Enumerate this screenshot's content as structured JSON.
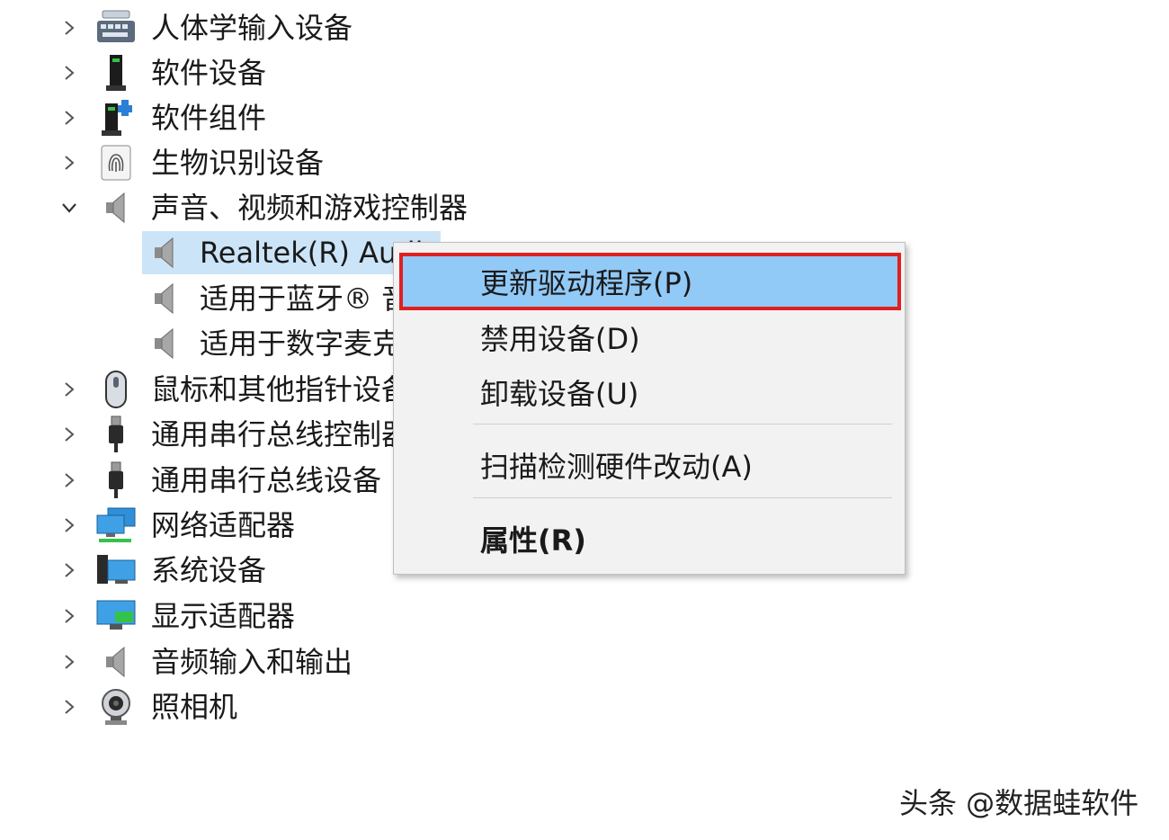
{
  "tree": {
    "categories_top": [
      {
        "label": "人体学输入设备",
        "icon": "keyboard-icon",
        "expanded": false
      },
      {
        "label": "软件设备",
        "icon": "tower-icon",
        "expanded": false
      },
      {
        "label": "软件组件",
        "icon": "tower-puzzle-icon",
        "expanded": false
      },
      {
        "label": "生物识别设备",
        "icon": "fingerprint-icon",
        "expanded": false
      },
      {
        "label": "声音、视频和游戏控制器",
        "icon": "speaker-icon",
        "expanded": true
      }
    ],
    "children": [
      {
        "label": "Realtek(R) Audio",
        "icon": "speaker-icon",
        "selected": true
      },
      {
        "label": "适用于蓝牙® 音频",
        "icon": "speaker-icon",
        "selected": false
      },
      {
        "label": "适用于数字麦克风",
        "icon": "speaker-icon",
        "selected": false
      }
    ],
    "categories_bottom": [
      {
        "label": "鼠标和其他指针设备",
        "icon": "mouse-icon",
        "expanded": false
      },
      {
        "label": "通用串行总线控制器",
        "icon": "usb-icon",
        "expanded": false
      },
      {
        "label": "通用串行总线设备",
        "icon": "usb-icon",
        "expanded": false
      },
      {
        "label": "网络适配器",
        "icon": "network-icon",
        "expanded": false
      },
      {
        "label": "系统设备",
        "icon": "system-icon",
        "expanded": false
      },
      {
        "label": "显示适配器",
        "icon": "display-icon",
        "expanded": false
      },
      {
        "label": "音频输入和输出",
        "icon": "speaker-icon",
        "expanded": false
      },
      {
        "label": "照相机",
        "icon": "camera-icon",
        "expanded": false
      }
    ]
  },
  "context_menu": {
    "items": [
      {
        "label": "更新驱动程序(P)",
        "highlighted": true,
        "bold": false
      },
      {
        "label": "禁用设备(D)",
        "highlighted": false,
        "bold": false
      },
      {
        "label": "卸载设备(U)",
        "highlighted": false,
        "bold": false
      },
      {
        "label": "扫描检测硬件改动(A)",
        "highlighted": false,
        "bold": false
      },
      {
        "label": "属性(R)",
        "highlighted": false,
        "bold": true
      }
    ]
  },
  "watermark": "头条 @数据蛙软件",
  "colors": {
    "selection": "#cce4f7",
    "menu_highlight": "#91c9f7",
    "callout_border": "#e02020",
    "menu_bg": "#f2f2f2"
  }
}
